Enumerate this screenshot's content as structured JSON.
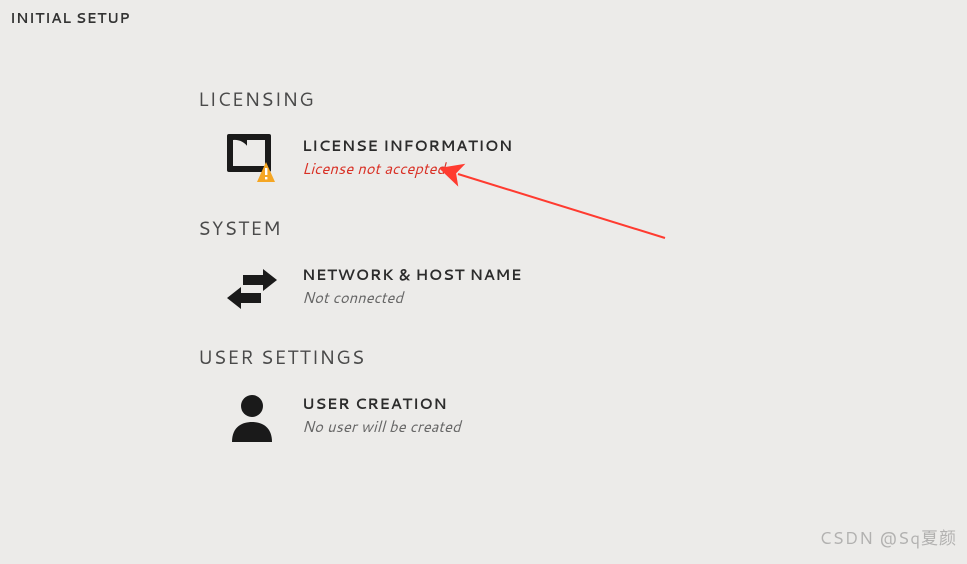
{
  "header": {
    "title": "INITIAL SETUP"
  },
  "sections": {
    "licensing": {
      "heading": "LICENSING",
      "license_info": {
        "title": "LICENSE INFORMATION",
        "status": "License not accepted",
        "status_warning": true
      }
    },
    "system": {
      "heading": "SYSTEM",
      "network": {
        "title": "NETWORK & HOST NAME",
        "status": "Not connected"
      }
    },
    "user_settings": {
      "heading": "USER SETTINGS",
      "user_creation": {
        "title": "USER CREATION",
        "status": "No user will be created"
      }
    }
  },
  "colors": {
    "warning_orange": "#f5a623",
    "icon_black": "#1a1a1a",
    "error_red": "#d93025",
    "annotation_red": "#ff3b30"
  },
  "watermark": "CSDN @Sq夏颜"
}
